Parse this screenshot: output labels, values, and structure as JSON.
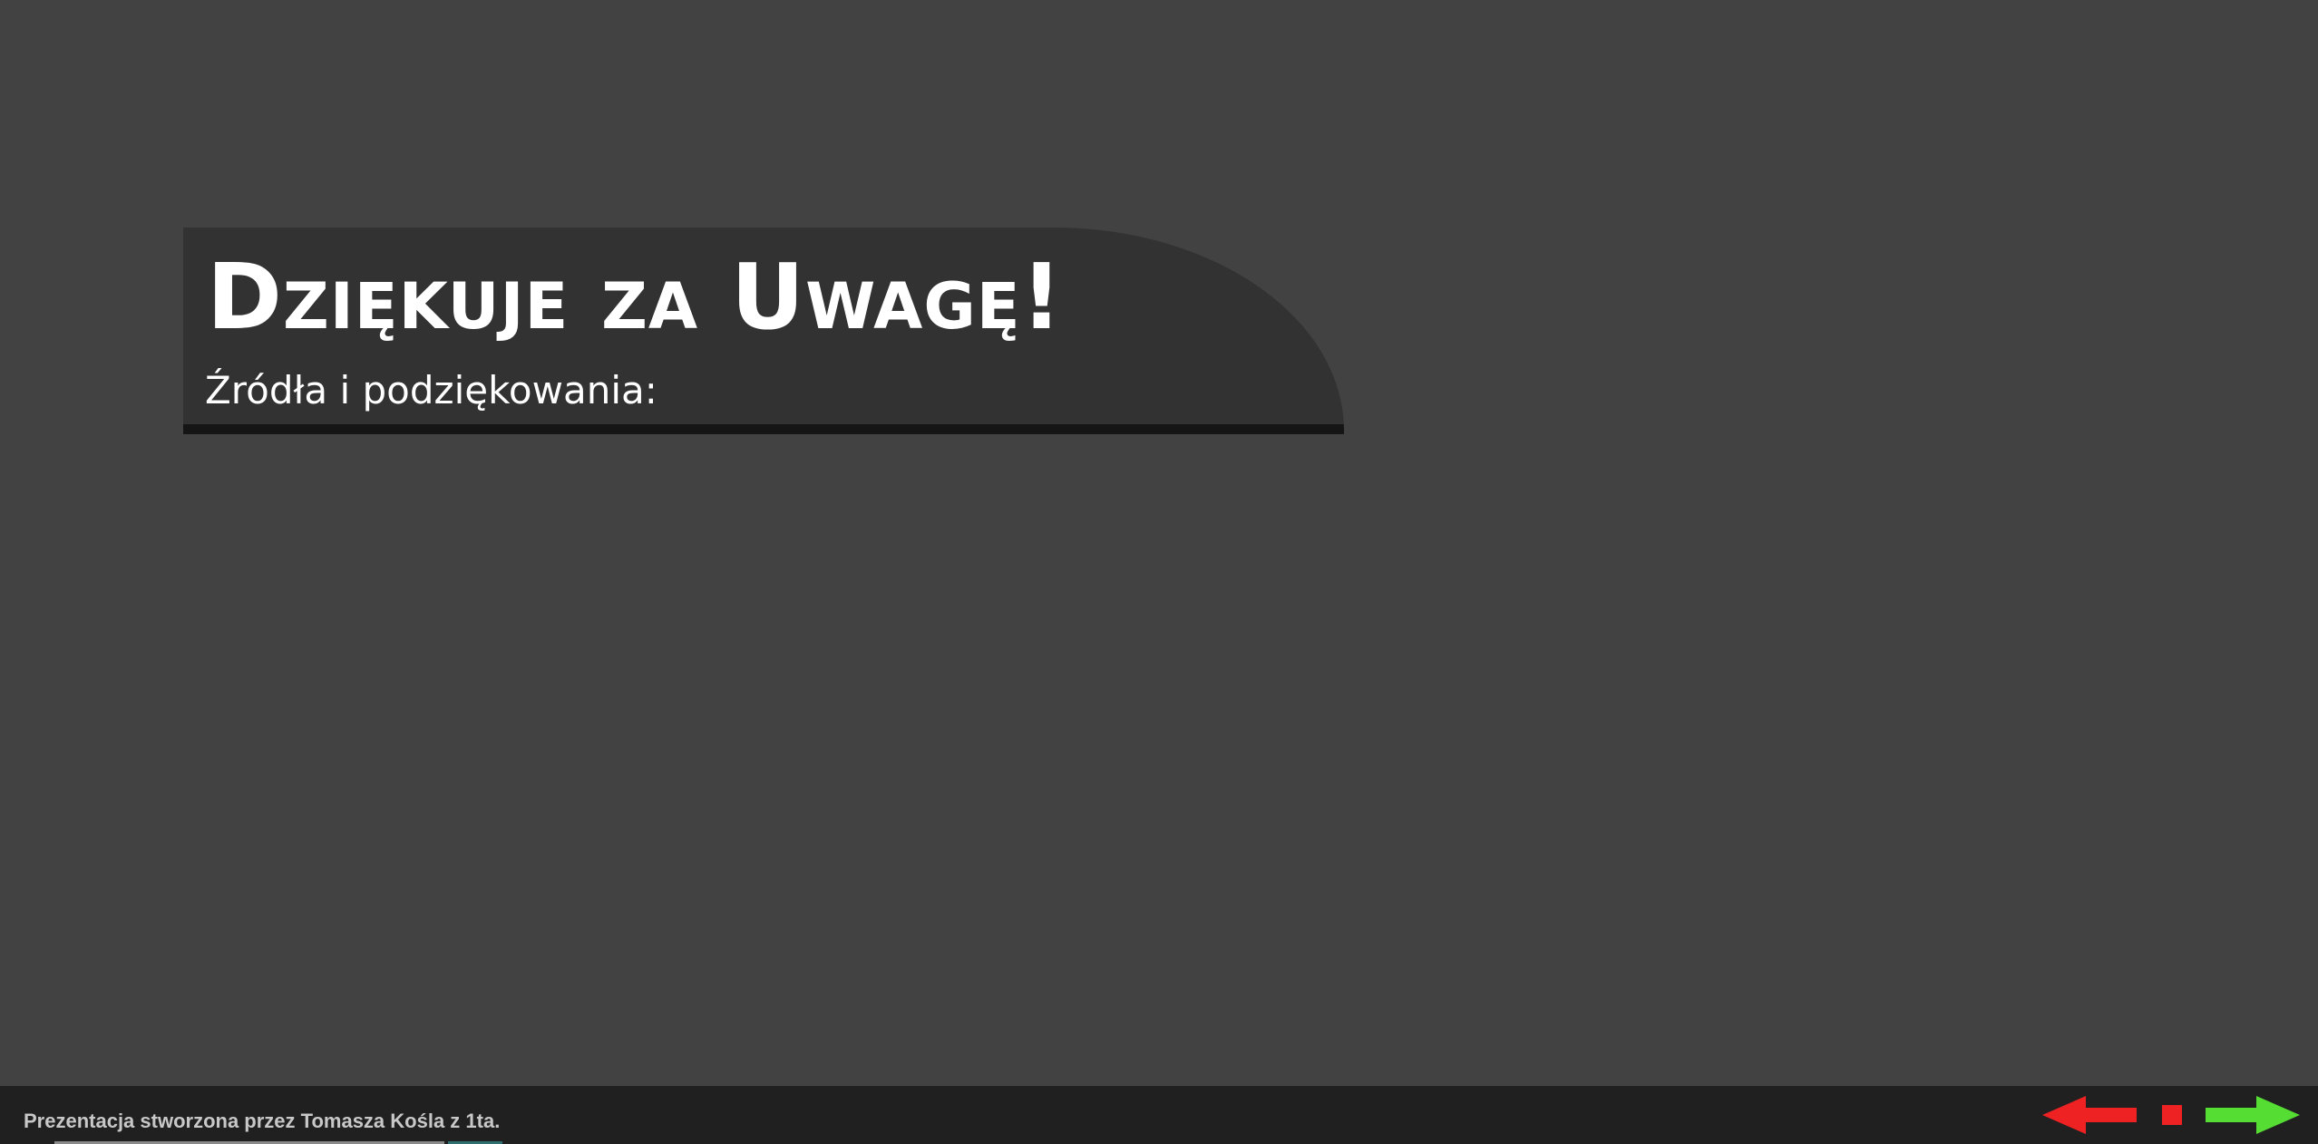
{
  "slide": {
    "title": "Dziękuje za Uwagę!",
    "subtitle": "Źródła i podziękowania:"
  },
  "footer": {
    "credit": "Prezentacja stworzona przez Tomasza Kośla z 1ta."
  },
  "navigation": {
    "prev_icon": "arrow-left-icon",
    "stop_icon": "stop-icon",
    "next_icon": "arrow-right-icon"
  },
  "colors": {
    "background": "#424242",
    "title_panel": "#323232",
    "footer": "#202020",
    "prev_arrow": "#ee2222",
    "stop": "#ee2222",
    "next_arrow": "#55dd33"
  }
}
